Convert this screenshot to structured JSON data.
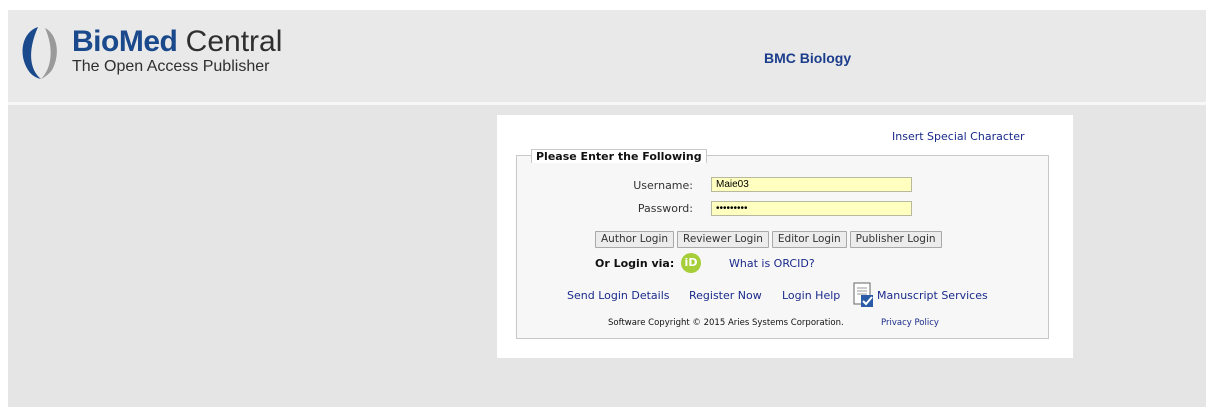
{
  "header": {
    "brand_bold": "BioMed",
    "brand_light": "Central",
    "tagline": "The Open Access Publisher",
    "journal_title": "BMC Biology"
  },
  "login": {
    "special_character_link": "Insert Special Character",
    "legend": "Please Enter the Following",
    "username_label": "Username:",
    "username_value": "Maie03",
    "password_label": "Password:",
    "password_value": "•••••••••",
    "buttons": [
      "Author Login",
      "Reviewer Login",
      "Editor Login",
      "Publisher Login"
    ],
    "or_login_via": "Or Login via:",
    "orcid_icon_text": "iD",
    "what_is_orcid": "What is ORCID?",
    "links": {
      "send_login_details": "Send Login Details",
      "register_now": "Register Now",
      "login_help": "Login Help",
      "manuscript_services": "Manuscript Services"
    },
    "copyright": "Software Copyright © 2015 Aries Systems Corporation.",
    "privacy_policy": "Privacy Policy"
  },
  "colors": {
    "brand_blue": "#1a4a8c",
    "link_blue": "#1a2a8a",
    "input_yellow": "#ffffc0",
    "orcid_green": "#a6ce39"
  },
  "icons": [
    "biomed-logo-icon",
    "orcid-icon",
    "manuscript-services-icon"
  ]
}
